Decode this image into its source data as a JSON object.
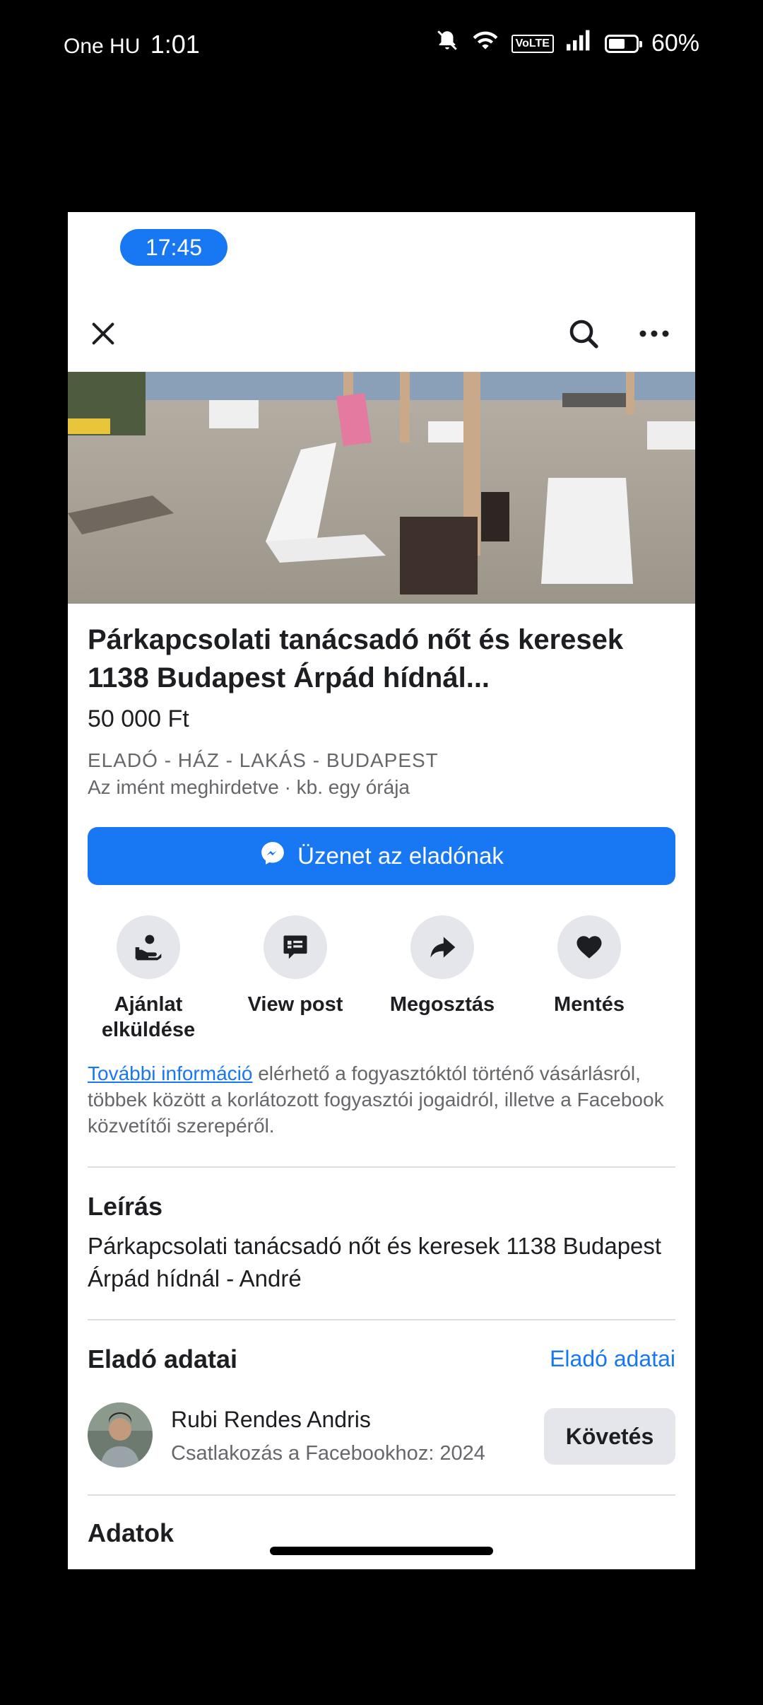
{
  "status_bar": {
    "carrier": "One HU",
    "time": "1:01",
    "volte": "VoLTE",
    "battery": "60%",
    "battery_level": 0.6
  },
  "screenshot": {
    "time_pill": "17:45",
    "title": "Párkapcsolati tanácsadó nőt és keresek 1138 Budapest Árpád hídnál...",
    "price": "50 000 Ft",
    "category": "ELADÓ - HÁZ - LAKÁS - BUDAPEST",
    "posted": "Az imént meghirdetve · kb. egy órája",
    "message_button": "Üzenet az eladónak",
    "actions": [
      {
        "label": "Ajánlat elküldése",
        "icon": "offer-icon"
      },
      {
        "label": "View post",
        "icon": "post-icon"
      },
      {
        "label": "Megosztás",
        "icon": "share-icon"
      },
      {
        "label": "Mentés",
        "icon": "heart-icon"
      }
    ],
    "info": {
      "link": "További információ",
      "text": " elérhető a fogyasztóktól történő vásárlásról, többek között a korlátozott fogyasztói jogaidról, illetve a Facebook közvetítői szerepéről."
    },
    "description_heading": "Leírás",
    "description": "Párkapcsolati tanácsadó nőt és keresek 1138 Budapest Árpád hídnál - André",
    "seller_heading": "Eladó adatai",
    "seller_link": "Eladó adatai",
    "seller": {
      "name": "Rubi Rendes Andris",
      "joined": "Csatlakozás a Facebookhoz: 2024"
    },
    "follow_button": "Követés",
    "details_heading": "Adatok"
  },
  "colors": {
    "accent": "#1877f2",
    "secondary_text": "#65676b",
    "button_gray": "#e4e6eb"
  }
}
